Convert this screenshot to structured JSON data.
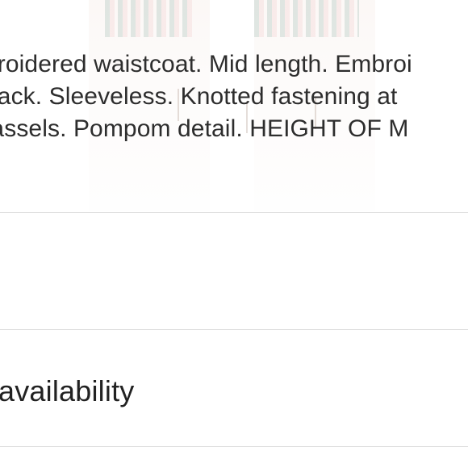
{
  "description": {
    "lines": [
      "broidered waistcoat. Mid length. Embroi",
      " back. Sleeveless. Knotted fastening at",
      " tassels. Pompom detail. HEIGHT OF M"
    ]
  },
  "availability": {
    "label": "availability"
  },
  "colors": {
    "text": "#2d2d2d",
    "divider": "#dcdcdc",
    "background": "#ffffff"
  }
}
